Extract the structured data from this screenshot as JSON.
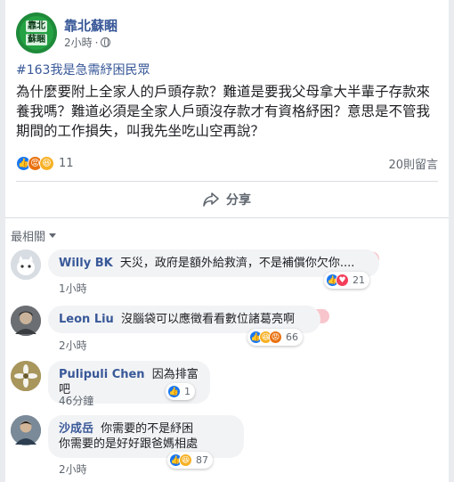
{
  "post": {
    "page_name": "靠北蘇睏",
    "avatar_text_1": "靠北",
    "avatar_text_2": "蘇睏",
    "time": "2小時",
    "dot": "·",
    "hashtag": "#163我是急需紓困民眾",
    "text": "為什麼要附上全家人的戶頭存款？難道是要我父母拿大半輩子存款來養我嗎？難道必須是全家人戶頭沒存款才有資格紓困？意思是不管我期間的工作損失，叫我先坐吃山空再說？",
    "reaction_count": "11",
    "comment_count": "20則留言",
    "share_label": "分享"
  },
  "comments_section": {
    "sort_label": "最相關"
  },
  "comments": [
    {
      "name": "Willy BK",
      "text": "天災，政府是額外給救濟，不是補償你欠你....",
      "time": "1小時",
      "reactions": "21"
    },
    {
      "name": "Leon Liu",
      "text": "沒腦袋可以應徵看看數位諸葛亮啊",
      "time": "2小時",
      "reactions": "66"
    },
    {
      "name": "Pulipuli Chen",
      "text": "因為排富吧",
      "time": "46分鐘",
      "reactions": "1"
    },
    {
      "name": "沙成岳",
      "text_line1": "你需要的不是紓困",
      "text_line2": "你需要的是好好跟爸媽相處",
      "time": "2小時",
      "reactions": "87"
    }
  ],
  "colors": {
    "link": "#385898",
    "like": "#1877f2",
    "highlight": "#ec5a6e"
  }
}
